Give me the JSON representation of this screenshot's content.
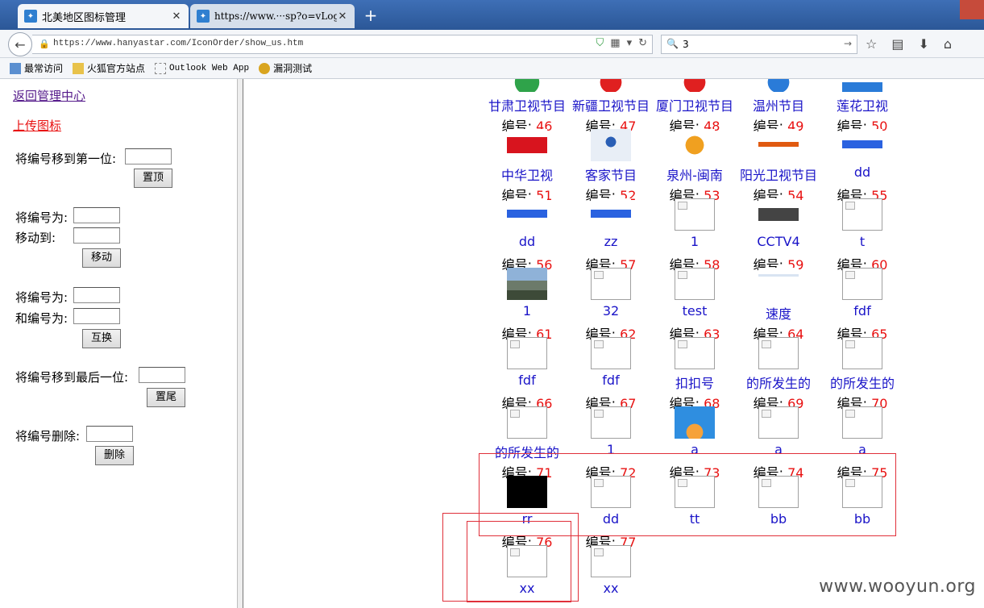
{
  "browser": {
    "tabs": [
      {
        "title": "北美地区图标管理",
        "close": "✕"
      },
      {
        "title": "https://www.···sp?o=vLogin",
        "close": "✕"
      }
    ],
    "new_tab": "+",
    "url": "https://www.hanyastar.com/IconOrder/show_us.htm",
    "search_value": "3",
    "bookmarks": [
      "最常访问",
      "火狐官方站点",
      "Outlook Web App",
      "漏洞测试"
    ]
  },
  "sidebar": {
    "back_link": "返回管理中心",
    "upload_link": "上传图标",
    "move_first_label": "将编号移到第一位:",
    "top_button": "置顶",
    "move_number_label": "将编号为:",
    "move_to_label": "移动到:",
    "move_button": "移动",
    "swap_a_label": "将编号为:",
    "swap_b_label": "和编号为:",
    "swap_button": "互换",
    "move_last_label": "将编号移到最后一位:",
    "bottom_button": "置尾",
    "delete_label": "将编号删除:",
    "delete_button": "删除"
  },
  "number_prefix": "编号: ",
  "icons": [
    {
      "name": "甘肃卫视节目",
      "number": "46",
      "img": "green-logo"
    },
    {
      "name": "新疆卫视节目",
      "number": "47",
      "img": "red-logo"
    },
    {
      "name": "厦门卫视节目",
      "number": "48",
      "img": "red-logo"
    },
    {
      "name": "温州节目",
      "number": "49",
      "img": "blue-logo"
    },
    {
      "name": "莲花卫视",
      "number": "50",
      "img": "macau-logo"
    },
    {
      "name": "中华卫视",
      "number": "51",
      "img": "chtv-logo"
    },
    {
      "name": "客家节目",
      "number": "52",
      "img": "hakka-logo"
    },
    {
      "name": "泉州-闽南",
      "number": "53",
      "img": "quanzhou-logo"
    },
    {
      "name": "阳光卫视节目",
      "number": "54",
      "img": "sunty-logo"
    },
    {
      "name": "dd",
      "number": "55",
      "img": "baidu-logo"
    },
    {
      "name": "dd",
      "number": "56",
      "img": "baidu-logo"
    },
    {
      "name": "zz",
      "number": "57",
      "img": "baidu-logo"
    },
    {
      "name": "1",
      "number": "58",
      "img": "broken"
    },
    {
      "name": "CCTV4",
      "number": "59",
      "img": "cctv4-logo"
    },
    {
      "name": "t",
      "number": "60",
      "img": "broken"
    },
    {
      "name": "1",
      "number": "61",
      "img": "house-photo"
    },
    {
      "name": "32",
      "number": "62",
      "img": "broken"
    },
    {
      "name": "test",
      "number": "63",
      "img": "broken"
    },
    {
      "name": "速度",
      "number": "64",
      "img": "webpage-thumb"
    },
    {
      "name": "fdf",
      "number": "65",
      "img": "broken"
    },
    {
      "name": "fdf",
      "number": "66",
      "img": "broken"
    },
    {
      "name": "fdf",
      "number": "67",
      "img": "broken"
    },
    {
      "name": "扣扣号",
      "number": "68",
      "img": "broken"
    },
    {
      "name": "的所发生的",
      "number": "69",
      "img": "broken"
    },
    {
      "name": "的所发生的",
      "number": "70",
      "img": "broken"
    },
    {
      "name": "的所发生的",
      "number": "71",
      "img": "broken"
    },
    {
      "name": "1",
      "number": "72",
      "img": "broken"
    },
    {
      "name": "a",
      "number": "73",
      "img": "sky-photo"
    },
    {
      "name": "a",
      "number": "74",
      "img": "broken"
    },
    {
      "name": "a",
      "number": "75",
      "img": "broken"
    },
    {
      "name": "rr",
      "number": "76",
      "img": "black-sketch"
    },
    {
      "name": "dd",
      "number": "77",
      "img": "broken"
    },
    {
      "name": "tt",
      "number": "",
      "img": "broken"
    },
    {
      "name": "bb",
      "number": "",
      "img": "broken"
    },
    {
      "name": "bb",
      "number": "",
      "img": "broken"
    },
    {
      "name": "xx",
      "number": "",
      "img": "broken"
    },
    {
      "name": "xx",
      "number": "",
      "img": "broken"
    }
  ],
  "watermark": "www.wooyun.org",
  "colors": {
    "link": "#1a14c8",
    "number": "#e81010",
    "annotation": "#e0303a"
  }
}
